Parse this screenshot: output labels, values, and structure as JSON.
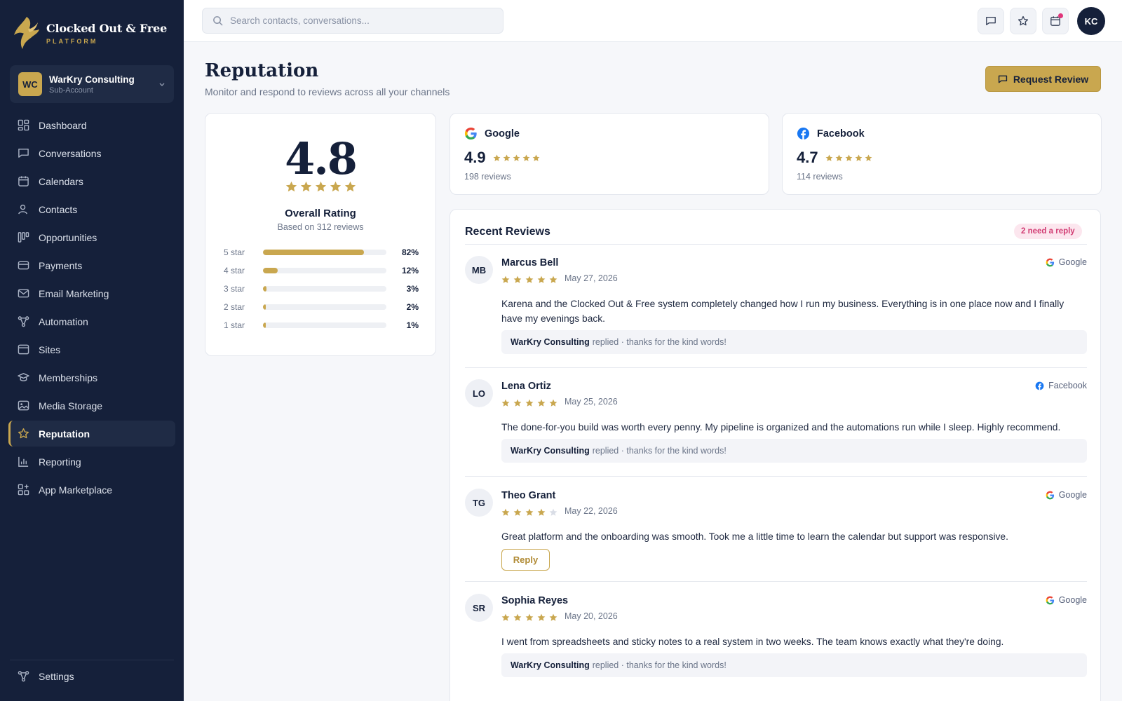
{
  "brand": {
    "name": "Clocked Out & Free",
    "sub": "PLATFORM"
  },
  "account": {
    "initials": "WC",
    "name": "WarKry Consulting",
    "type": "Sub-Account"
  },
  "nav": {
    "items": [
      {
        "label": "Dashboard",
        "icon": "dashboard-icon"
      },
      {
        "label": "Conversations",
        "icon": "chat-icon"
      },
      {
        "label": "Calendars",
        "icon": "calendar-icon"
      },
      {
        "label": "Contacts",
        "icon": "contacts-icon"
      },
      {
        "label": "Opportunities",
        "icon": "pipeline-icon"
      },
      {
        "label": "Payments",
        "icon": "credit-card-icon"
      },
      {
        "label": "Email Marketing",
        "icon": "mail-icon"
      },
      {
        "label": "Automation",
        "icon": "workflow-icon"
      },
      {
        "label": "Sites",
        "icon": "browser-icon"
      },
      {
        "label": "Memberships",
        "icon": "graduation-cap-icon"
      },
      {
        "label": "Media Storage",
        "icon": "image-icon"
      },
      {
        "label": "Reputation",
        "icon": "star-icon",
        "active": true
      },
      {
        "label": "Reporting",
        "icon": "bar-chart-icon"
      },
      {
        "label": "App Marketplace",
        "icon": "apps-icon"
      }
    ],
    "settings": "Settings"
  },
  "search": {
    "placeholder": "Search contacts, conversations...",
    "value": ""
  },
  "user": {
    "initials": "KC"
  },
  "page": {
    "title": "Reputation",
    "subtitle": "Monitor and respond to reviews across all your channels",
    "request_button": "Request Review"
  },
  "overall": {
    "value": "4.8",
    "stars": 5,
    "label": "Overall Rating",
    "basis": "Based on 312 reviews",
    "distribution": [
      {
        "label": "5 star",
        "pct": "82%",
        "fraction": 0.82
      },
      {
        "label": "4 star",
        "pct": "12%",
        "fraction": 0.12
      },
      {
        "label": "3 star",
        "pct": "3%",
        "fraction": 0.03
      },
      {
        "label": "2 star",
        "pct": "2%",
        "fraction": 0.02
      },
      {
        "label": "1 star",
        "pct": "1%",
        "fraction": 0.01
      }
    ]
  },
  "sources": [
    {
      "name": "Google",
      "rating": "4.9",
      "count": "198 reviews",
      "stars": 5
    },
    {
      "name": "Facebook",
      "rating": "4.7",
      "count": "114 reviews",
      "stars": 5
    }
  ],
  "reviews": {
    "title": "Recent Reviews",
    "badge": "2 need a reply",
    "reply_button": "Reply",
    "replied_by": "WarKry Consulting",
    "reply_note": "replied · thanks for the kind words!",
    "items": [
      {
        "initials": "MB",
        "name": "Marcus Bell",
        "stars": 5,
        "date": "May 27, 2026",
        "source": "Google",
        "text": "Karena and the Clocked Out & Free system completely changed how I run my business. Everything is in one place now and I finally have my evenings back.",
        "replied": true
      },
      {
        "initials": "LO",
        "name": "Lena Ortiz",
        "stars": 5,
        "date": "May 25, 2026",
        "source": "Facebook",
        "text": "The done-for-you build was worth every penny. My pipeline is organized and the automations run while I sleep. Highly recommend.",
        "replied": true
      },
      {
        "initials": "TG",
        "name": "Theo Grant",
        "stars": 4,
        "date": "May 22, 2026",
        "source": "Google",
        "text": "Great platform and the onboarding was smooth. Took me a little time to learn the calendar but support was responsive.",
        "replied": false
      },
      {
        "initials": "SR",
        "name": "Sophia Reyes",
        "stars": 5,
        "date": "May 20, 2026",
        "source": "Google",
        "text": "I went from spreadsheets and sticky notes to a real system in two weeks. The team knows exactly what they're doing.",
        "replied": true
      }
    ]
  },
  "colors": {
    "sidebar": "#15203a",
    "accent": "#c9a74f",
    "badge_text": "#d13b72",
    "badge_bg": "#fce6ee"
  }
}
